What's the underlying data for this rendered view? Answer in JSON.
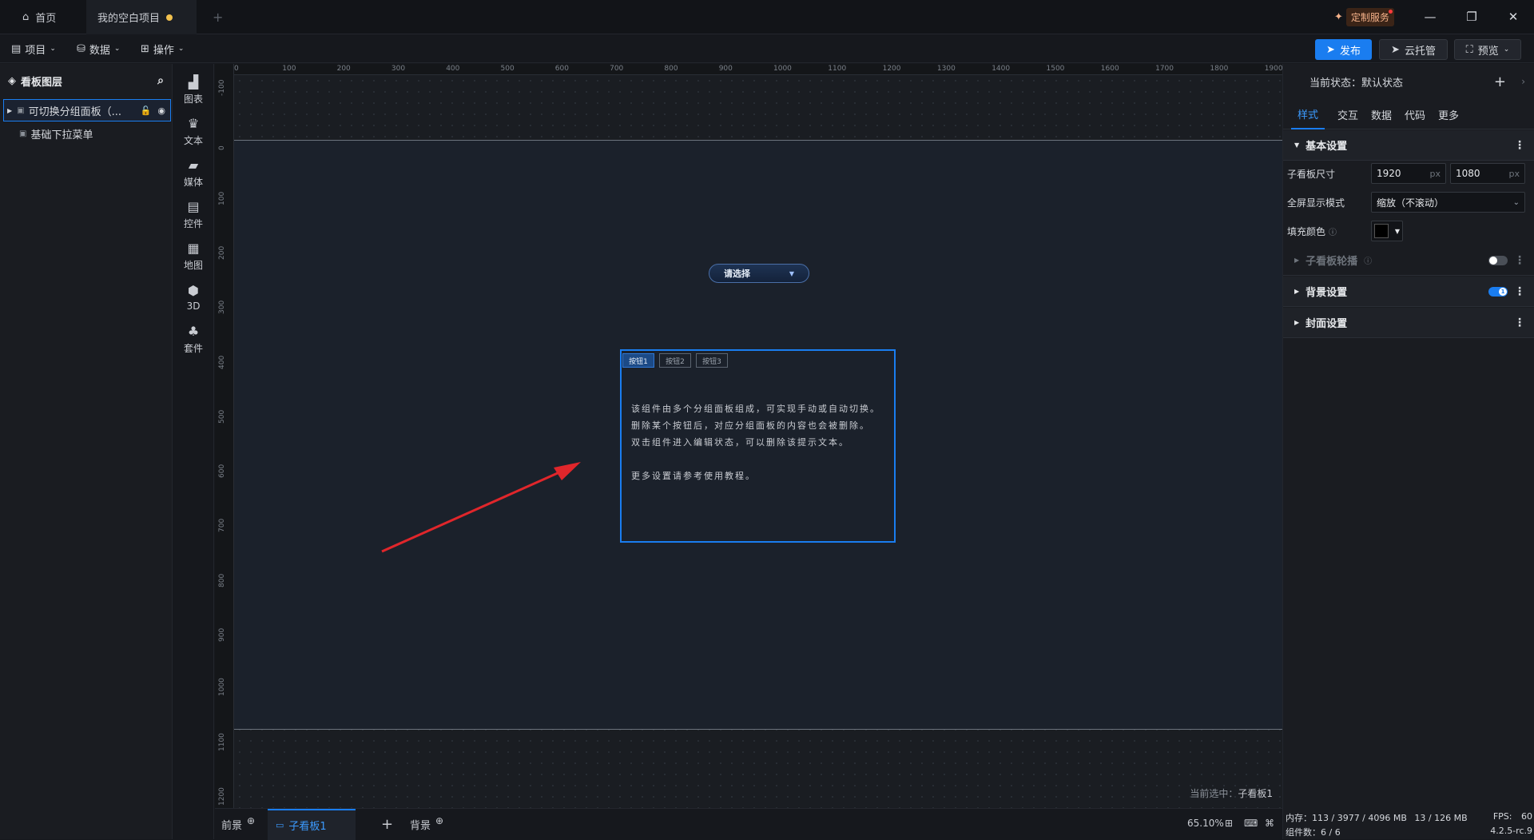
{
  "titlebar": {
    "tabs": [
      {
        "label": "首页"
      },
      {
        "label": "我的空白项目"
      }
    ],
    "new_tab": "+",
    "service": "定制服务"
  },
  "toolbar": {
    "menus": [
      {
        "label": "项目"
      },
      {
        "label": "数据"
      },
      {
        "label": "操作"
      }
    ],
    "publish": "发布",
    "cloud": "云托管",
    "preview": "预览"
  },
  "layers": {
    "title": "看板图层",
    "items": [
      {
        "label": "可切换分组面板（..."
      },
      {
        "label": "基础下拉菜单"
      }
    ]
  },
  "components": [
    {
      "label": "图表",
      "icon": "chart-icon"
    },
    {
      "label": "文本",
      "icon": "text-icon"
    },
    {
      "label": "媒体",
      "icon": "media-icon"
    },
    {
      "label": "控件",
      "icon": "control-icon"
    },
    {
      "label": "地图",
      "icon": "map-icon"
    },
    {
      "label": "3D",
      "icon": "cube-icon"
    },
    {
      "label": "套件",
      "icon": "kit-icon"
    }
  ],
  "ruler": {
    "top": [
      "0",
      "100",
      "200",
      "300",
      "400",
      "500",
      "600",
      "700",
      "800",
      "900",
      "1000",
      "1100",
      "1200",
      "1300",
      "1400",
      "1500",
      "1600",
      "1700",
      "1800",
      "1900"
    ],
    "left": [
      "-100",
      "0",
      "100",
      "200",
      "300",
      "400",
      "500",
      "600",
      "700",
      "800",
      "900",
      "1000",
      "1100",
      "1200"
    ]
  },
  "canvas": {
    "dropdown_placeholder": "请选择",
    "panel_buttons": [
      "按钮1",
      "按钮2",
      "按钮3"
    ],
    "panel_text": [
      "该组件由多个分组面板组成，可实现手动或自动切换。",
      "删除某个按钮后，对应分组面板的内容也会被删除。",
      "双击组件进入编辑状态，可以删除该提示文本。",
      "",
      "更多设置请参考使用教程。"
    ],
    "selected_label": "当前选中：",
    "selected_value": "子看板1"
  },
  "bottom": {
    "tabs": [
      {
        "label": "前景"
      },
      {
        "label": "子看板1"
      },
      {
        "label": "背景"
      }
    ],
    "add": "+",
    "zoom": "65.10%"
  },
  "props": {
    "state_label": "当前状态：",
    "state_value": "默认状态",
    "tabs": [
      "样式",
      "交互",
      "数据",
      "代码",
      "更多"
    ],
    "sections": {
      "basic": "基本设置",
      "carousel": "子看板轮播",
      "background": "背景设置",
      "cover": "封面设置"
    },
    "size_label": "子看板尺寸",
    "width": "1920",
    "height": "1080",
    "unit": "px",
    "fullscreen_label": "全屏显示模式",
    "fullscreen_value": "缩放（不滚动）",
    "fill_label": "填充颜色",
    "fill_color": "#000000",
    "bg_toggle_on": "1"
  },
  "status": {
    "memory_label": "内存：",
    "memory_value": "113 / 3977 / 4096 MB",
    "memory_extra": "13 / 126 MB",
    "fps_label": "FPS:",
    "fps_value": "60",
    "comp_label": "组件数：",
    "comp_value": "6 / 6",
    "version": "4.2.5-rc.9"
  },
  "colors": {
    "accent": "#1a7df0",
    "arrow": "#e0262b"
  }
}
